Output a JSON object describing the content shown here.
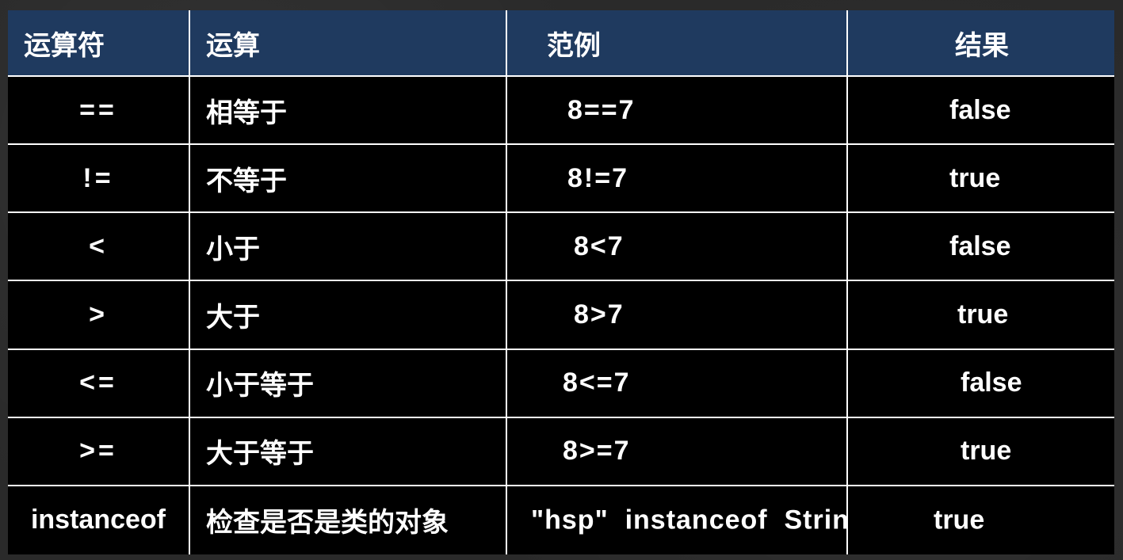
{
  "table": {
    "headers": [
      "运算符",
      "运算",
      "范例",
      "结果"
    ],
    "rows": [
      {
        "operator": "==",
        "name": "相等于",
        "example": "8==7",
        "result": "false"
      },
      {
        "operator": "!=",
        "name": "不等于",
        "example": "8!=7",
        "result": "true"
      },
      {
        "operator": "<",
        "name": "小于",
        "example": "8<7",
        "result": "false"
      },
      {
        "operator": ">",
        "name": "大于",
        "example": "8>7",
        "result": "true"
      },
      {
        "operator": "<=",
        "name": "小于等于",
        "example": "8<=7",
        "result": "false"
      },
      {
        "operator": ">=",
        "name": "大于等于",
        "example": "8>=7",
        "result": "true"
      },
      {
        "operator": "instanceof",
        "name": "检查是否是类的对象",
        "example": "\"hsp\"  instanceof  String",
        "result": "true"
      }
    ]
  },
  "colors": {
    "header_bg": "#1f3a5f",
    "body_bg": "#000000",
    "grid": "#ffffff",
    "text": "#ffffff",
    "page_bg": "#2a2a2a"
  }
}
